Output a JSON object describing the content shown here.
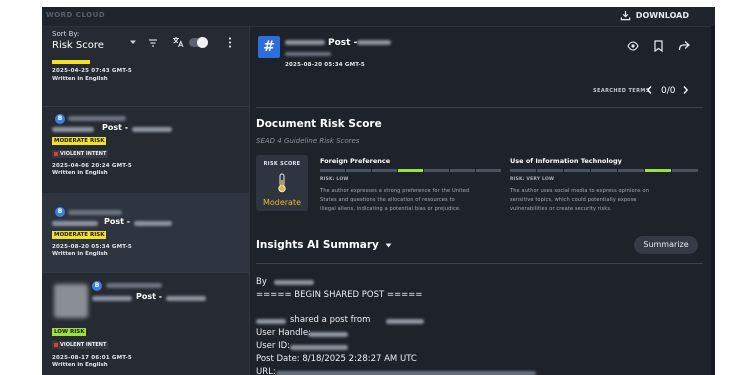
{
  "window": {
    "section_title": "WORD CLOUD",
    "download_label": "DOWNLOAD"
  },
  "sort": {
    "label": "Sort By:",
    "value": "Risk Score"
  },
  "items": [
    {
      "date": "2025-04-25 07:43 GMT-5",
      "language": "Written in English"
    },
    {
      "post_word": "Post -",
      "risk": "MODERATE RISK",
      "intent": "VIOLENT INTENT",
      "date": "2025-04-06 20:24 GMT-5",
      "language": "Written in English"
    },
    {
      "post_word": "Post -",
      "risk": "MODERATE RISK",
      "date": "2025-08-20 05:34 GMT-5",
      "language": "Written in English"
    },
    {
      "post_word": "Post -",
      "risk": "LOW RISK",
      "intent": "VIOLENT INTENT",
      "date": "2025-08-17 06:01 GMT-5",
      "language": "Written in English"
    }
  ],
  "detail": {
    "post_word": "Post -",
    "date": "2025-08-20 05:34 GMT-5",
    "searched_terms_label": "SEARCHED TERMS",
    "searched_count": "0/0",
    "document_risk_title": "Document Risk Score",
    "guideline_subtitle": "SEAD 4 Guideline Risk Scores",
    "risk_score_label": "RISK SCORE",
    "risk_score_value": "Moderate",
    "guidelines": [
      {
        "title": "Foreign Preference",
        "risk": "RISK: LOW",
        "level": 0.55,
        "description": [
          "The author expresses a strong preference for the United",
          "States and questions the allocation of resources to",
          "illegal aliens, indicating a potential bias or prejudice."
        ]
      },
      {
        "title": "Use of Information Technology",
        "risk": "RISK: VERY LOW",
        "level": 0.85,
        "description": [
          "The author uses social media to express opinions on",
          "sensitive topics, which could potentially expose",
          "vulnerabilities or create security risks."
        ]
      }
    ],
    "insights_title": "Insights AI Summary",
    "summarize_label": "Summarize",
    "summary_lines": {
      "by": "By",
      "begin": "===== BEGIN SHARED POST =====",
      "shared": "shared a post from",
      "handle": "User Handle:",
      "userid": "User ID:",
      "postdate": "Post Date: 8/18/2025 2:28:27 AM UTC",
      "url": "URL:"
    }
  },
  "colors": {
    "accent_blue": "#2c6fdc",
    "moderate_yellow": "#f2e125",
    "low_green": "#9be03d",
    "violent_red": "#e23838",
    "risk_gauge": "#e8b92a"
  }
}
